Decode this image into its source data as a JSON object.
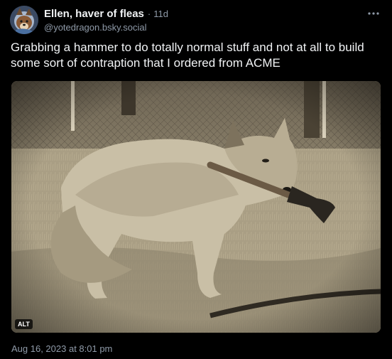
{
  "author": {
    "display_name": "Ellen, haver of fleas",
    "handle": "@yotedragon.bsky.social",
    "time_ago": "11d",
    "separator": "·"
  },
  "post": {
    "text": "Grabbing a hammer to do totally normal stuff and not at all to build some sort of contraption that I ordered from ACME",
    "timestamp": "Aug 16, 2023 at 8:01 pm",
    "image_alt_badge": "ALT"
  },
  "icons": {
    "more": "more-horizontal-icon",
    "avatar": "avatar-illustration"
  },
  "colors": {
    "background": "#000000",
    "primary_text": "#f1f3f5",
    "secondary_text": "#8f9aa8",
    "photo_tone": "#958a74"
  }
}
